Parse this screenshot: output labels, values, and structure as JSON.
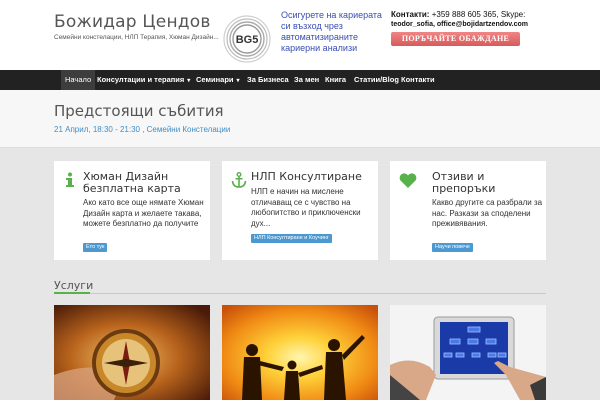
{
  "header": {
    "site_title": "Божидар Цендов",
    "tagline": "Семейни констелации, НЛП Терапия, Хюман Дизайн...",
    "logo_text": "BG5",
    "promo": "Осигурете на кариерата си възход чрез автоматизираните кариерни анализи",
    "contact_label": "Контакти:",
    "contact_phone": " +359 888 605 365, Skype:",
    "contact_email": "teodor_sofia, office@bojidartzendov.com",
    "call_button": "ПОРЪЧАЙТЕ ОБАЖДАНЕ"
  },
  "nav": {
    "items": [
      {
        "label": "Начало"
      },
      {
        "label": "Консултации и терапия"
      },
      {
        "label": "Семинари"
      },
      {
        "label": "За Бизнеса"
      },
      {
        "label": "За мен"
      },
      {
        "label": "Книга"
      },
      {
        "label": "Статии/Blog"
      },
      {
        "label": "Контакти"
      }
    ],
    "dropdown_marker": "▾"
  },
  "events": {
    "title": "Предстоящи събития",
    "item": "21 Април, 18:30 - 21:30 , Семейни Констелации"
  },
  "cards": [
    {
      "icon": "info-icon",
      "title": "Хюман Дизайн безплатна карта",
      "text": "Ако като все още нямате Хюман Дизайн карта и желаете такава, можете безплатно да получите",
      "button": "Ето тук"
    },
    {
      "icon": "anchor-icon",
      "title": "НЛП Консултиране",
      "text": "НЛП е начин на мислене отличаващ се с чувство на любопитство и приключенски дух...",
      "button": "НЛП Консултиране и Коучинг"
    },
    {
      "icon": "heart-icon",
      "title": "Отзиви и препоръки",
      "text": "Какво другите са разбрали за нас. Разкази за споделени преживявания.",
      "button": "Научи повече"
    }
  ],
  "services": {
    "title": "Услуги"
  },
  "colors": {
    "accent_green": "#58b14a",
    "link_blue": "#3f8ec7",
    "nav_bg": "#222222",
    "call_button": "#e06868"
  }
}
